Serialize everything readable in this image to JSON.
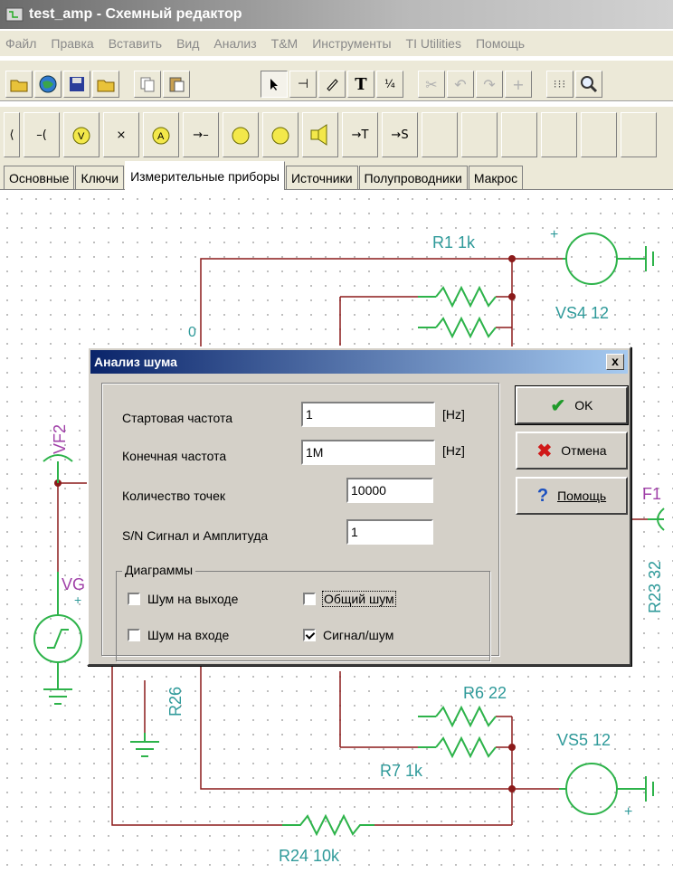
{
  "window": {
    "title": "test_amp - Схемный редактор"
  },
  "menu": [
    "Файл",
    "Правка",
    "Вставить",
    "Вид",
    "Анализ",
    "T&M",
    "Инструменты",
    "TI Utilities",
    "Помощь"
  ],
  "component_toolbar": {
    "ammeter_label": "A",
    "voltmeter_label": "V",
    "arrow_t": "→T",
    "arrow_s": "→S"
  },
  "tabs": [
    "Основные",
    "Ключи",
    "Измерительные приборы",
    "Источники",
    "Полупроводники",
    "Макрос"
  ],
  "schematic": {
    "labels": {
      "r1": "R1 1k",
      "vs4": "VS4 12",
      "vf2": "VF2",
      "vf1_partial": "F1",
      "r23": "R23 32",
      "vg_partial": "VG",
      "r26_partial": "R26",
      "r6": "R6 22",
      "vs5": "VS5 12",
      "r7": "R7 1k",
      "r24": "R24 10k",
      "plus": "+",
      "zero_partial": "0"
    }
  },
  "dialog": {
    "title": "Анализ шума",
    "close_label": "x",
    "fields": {
      "start_freq_label": "Стартовая частота",
      "start_freq_value": "1",
      "start_freq_unit": "[Hz]",
      "end_freq_label": "Конечная частота",
      "end_freq_value": "1M",
      "end_freq_unit": "[Hz]",
      "points_label": "Количество точек",
      "points_value": "10000",
      "sn_label": "S/N Сигнал и Амплитуда",
      "sn_value": "1"
    },
    "diagrams": {
      "caption": "Диаграммы",
      "output_noise": "Шум на выходе",
      "output_noise_checked": false,
      "total_noise": "Общий шум",
      "total_noise_checked": false,
      "input_noise": "Шум на входе",
      "input_noise_checked": false,
      "snr": "Сигнал/шум",
      "snr_checked": true
    },
    "buttons": {
      "ok": "OK",
      "cancel": "Отмена",
      "help": "Помощь"
    }
  },
  "colors": {
    "wire": "#8b1a1a",
    "component": "#2db34a",
    "label": "#2f9a9a",
    "source_label": "#a040a8"
  }
}
